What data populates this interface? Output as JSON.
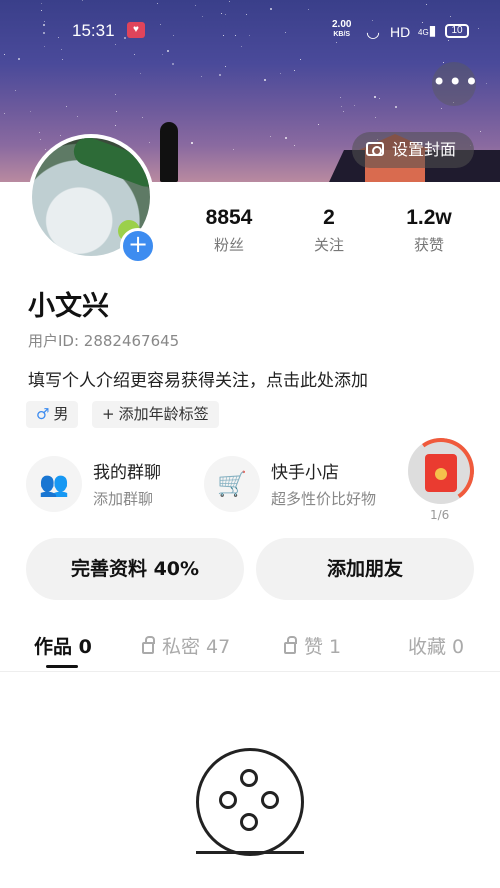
{
  "status_bar": {
    "time": "15:31",
    "net_speed": "2.00",
    "net_unit": "KB/S",
    "hd": "HD",
    "signal": "4G",
    "battery": "10"
  },
  "header": {
    "more_label": "•••",
    "cover_button": "设置封面"
  },
  "profile": {
    "stats": [
      {
        "value": "8854",
        "label": "粉丝"
      },
      {
        "value": "2",
        "label": "关注"
      },
      {
        "value": "1.2w",
        "label": "获赞"
      }
    ],
    "name": "小文兴",
    "user_id": "用户ID: 2882467645",
    "intro": "填写个人介绍更容易获得关注，点击此处添加",
    "tags": {
      "gender_symbol": "♂",
      "gender": "男",
      "add_age_symbol": "+",
      "add_age": "添加年龄标签"
    }
  },
  "features": {
    "group": {
      "title": "我的群聊",
      "subtitle": "添加群聊"
    },
    "shop": {
      "title": "快手小店",
      "subtitle": "超多性价比好物"
    },
    "redpack_count": "1/6"
  },
  "actions": {
    "complete_profile": "完善资料 40%",
    "add_friend": "添加朋友"
  },
  "tabs": [
    {
      "label": "作品 0"
    },
    {
      "label": "私密 47"
    },
    {
      "label": "赞 1"
    },
    {
      "label": "收藏 0"
    }
  ],
  "colors": {
    "accent": "#3d8cf0",
    "redpack": "#ea3b30"
  }
}
